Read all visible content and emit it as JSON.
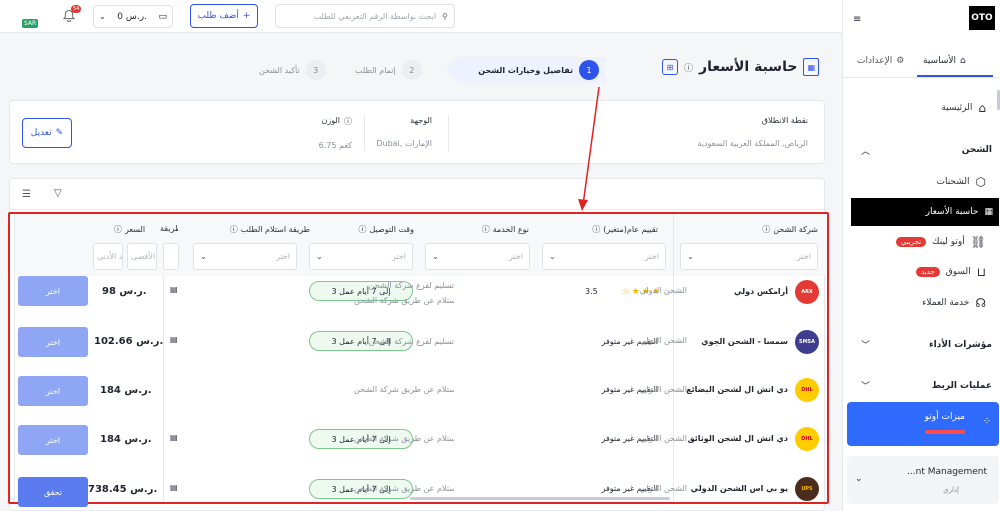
{
  "topbar": {
    "currency_badge": "SAR",
    "notif_count": "54",
    "balance": "0 ر.س.",
    "add_order": "أضف طلب",
    "search_placeholder": "ابحث بواسطة الرقم التعريفي للطلب"
  },
  "page": {
    "title": "حاسبة الأسعار"
  },
  "steps": [
    {
      "num": "1",
      "label": "تفاصيل وخيارات الشحن"
    },
    {
      "num": "2",
      "label": "إتمام الطلب"
    },
    {
      "num": "3",
      "label": "تأكيد الشحن"
    }
  ],
  "summary": {
    "origin_label": "نقطة الانطلاق",
    "origin_value": "الرياض, المملكة العربية السعودية",
    "dest_label": "الوجهة",
    "dest_value": "Dubai, الإمارات",
    "weight_label": "الوزن",
    "weight_value": "6.75 كغم",
    "edit": "تعديل"
  },
  "table": {
    "headers": {
      "carrier": "شركة الشحن",
      "rating": "تقييم عام(متغير)",
      "service": "نوع الخدمة",
      "delivery": "وقت التوصيل",
      "pickup": "طريقة استلام الطلب",
      "method": "طريقة",
      "price": "السعر"
    },
    "filter_placeholder": "اختر",
    "min_placeholder": "الحد الأدنى",
    "max_placeholder": "الحد الأقصى",
    "rows": [
      {
        "carrier": "أرامكس دولي",
        "rating": "3.5",
        "service": "الشحن الدولي",
        "delivery": "3 إلى 7 أيام عمل",
        "pickup1": "تسليم لفرع شركة الشحن",
        "pickup2": "الاستلام عن طريق شركة الشحن",
        "price": "98 ر.س.",
        "action": "اختر"
      },
      {
        "carrier": "سمسا - الشحن الجوي",
        "rating": "التقييم غير متوفر",
        "service": "الشحن الدولي",
        "delivery": "3 إلى 7 أيام عمل",
        "pickup1": "تسليم لفرع شركة الشحن",
        "pickup2": "",
        "price": "102.66 ر.س.",
        "action": "اختر"
      },
      {
        "carrier": "دي اتش ال لشحن البضائع",
        "rating": "التقييم غير متوفر",
        "service": "الشحن الدولي",
        "delivery": "",
        "pickup1": "",
        "pickup2": "الاستلام عن طريق شركة الشحن",
        "price": "184 ر.س.",
        "action": "اختر"
      },
      {
        "carrier": "دي اتش ال لشحن الوثائق",
        "rating": "التقييم غير متوفر",
        "service": "الشحن الدولي",
        "delivery": "3 إلى 7 أيام عمل",
        "pickup1": "",
        "pickup2": "الاستلام عن طريق شركة الشحن",
        "price": "184 ر.س.",
        "action": "اختر"
      },
      {
        "carrier": "يو بي اس الشحن الدولي",
        "rating": "التقييم غير متوفر",
        "service": "الشحن الدولي",
        "delivery": "3 إلى 7 أيام عمل",
        "pickup1": "",
        "pickup2": "الاستلام عن طريق شركة الشحن",
        "price": "738.45 ر.س.",
        "action": "تحقق"
      }
    ]
  },
  "sidebar": {
    "logo": "OTO",
    "tab_main": "الأساسية",
    "tab_settings": "الإعدادات",
    "home": "الرئيسية",
    "shipping": "الشحن",
    "shipments": "الشحنات",
    "price_calc": "حاسبة الأسعار",
    "oto_link": "أوتو لينك",
    "oto_link_tag": "تجريبي",
    "market": "السوق",
    "market_tag": "جديد",
    "customer_service": "خدمة العملاء",
    "kpis": "مؤشرات الأداء",
    "integrations": "عمليات الربط",
    "oto_features": "ميزات أوتو",
    "account_name": "...nt Management",
    "account_role": "إداري"
  }
}
